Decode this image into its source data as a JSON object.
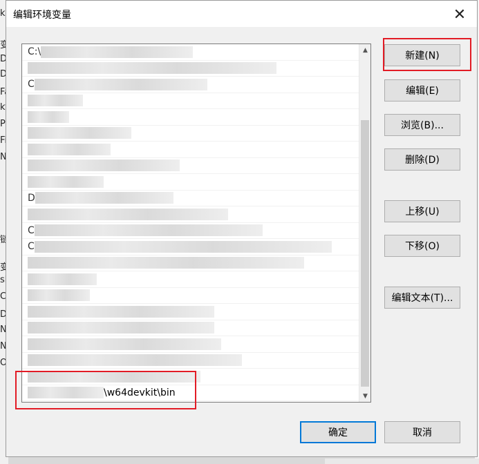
{
  "dialog": {
    "title": "编辑环境变量"
  },
  "list": {
    "entries": [
      {
        "lead": "C:\\",
        "text": ""
      },
      {
        "lead": "",
        "text": ""
      },
      {
        "lead": "C",
        "text": ""
      },
      {
        "lead": "",
        "text": ""
      },
      {
        "lead": "",
        "text": ""
      },
      {
        "lead": "",
        "text": ""
      },
      {
        "lead": "",
        "text": ""
      },
      {
        "lead": "",
        "text": ""
      },
      {
        "lead": "",
        "text": ""
      },
      {
        "lead": "D",
        "text": ""
      },
      {
        "lead": "",
        "text": ""
      },
      {
        "lead": "C",
        "text": ""
      },
      {
        "lead": "C",
        "text": ""
      },
      {
        "lead": "",
        "text": ""
      },
      {
        "lead": "",
        "text": ""
      },
      {
        "lead": "",
        "text": ""
      },
      {
        "lead": "",
        "text": ""
      },
      {
        "lead": "",
        "text": ""
      },
      {
        "lead": "",
        "text": ""
      },
      {
        "lead": "",
        "text": ""
      },
      {
        "lead": "",
        "text": ""
      },
      {
        "lead": "",
        "text": "\\w64devkit\\bin"
      }
    ]
  },
  "buttons": {
    "new": "新建(N)",
    "edit": "编辑(E)",
    "browse": "浏览(B)...",
    "delete": "删除(D)",
    "move_up": "上移(U)",
    "move_down": "下移(O)",
    "edit_text": "编辑文本(T)...",
    "ok": "确定",
    "cancel": "取消"
  },
  "background_left_letters": [
    "ka",
    "变",
    "Da",
    "Dr",
    "Fa",
    "ky",
    "Py",
    "Fi",
    "Nu",
    "链",
    "变",
    "sk",
    "Cd",
    "Dr",
    "NU",
    "NU",
    "OS"
  ],
  "colors": {
    "highlight_red": "#e21b25",
    "default_button_border": "#0078d7"
  }
}
